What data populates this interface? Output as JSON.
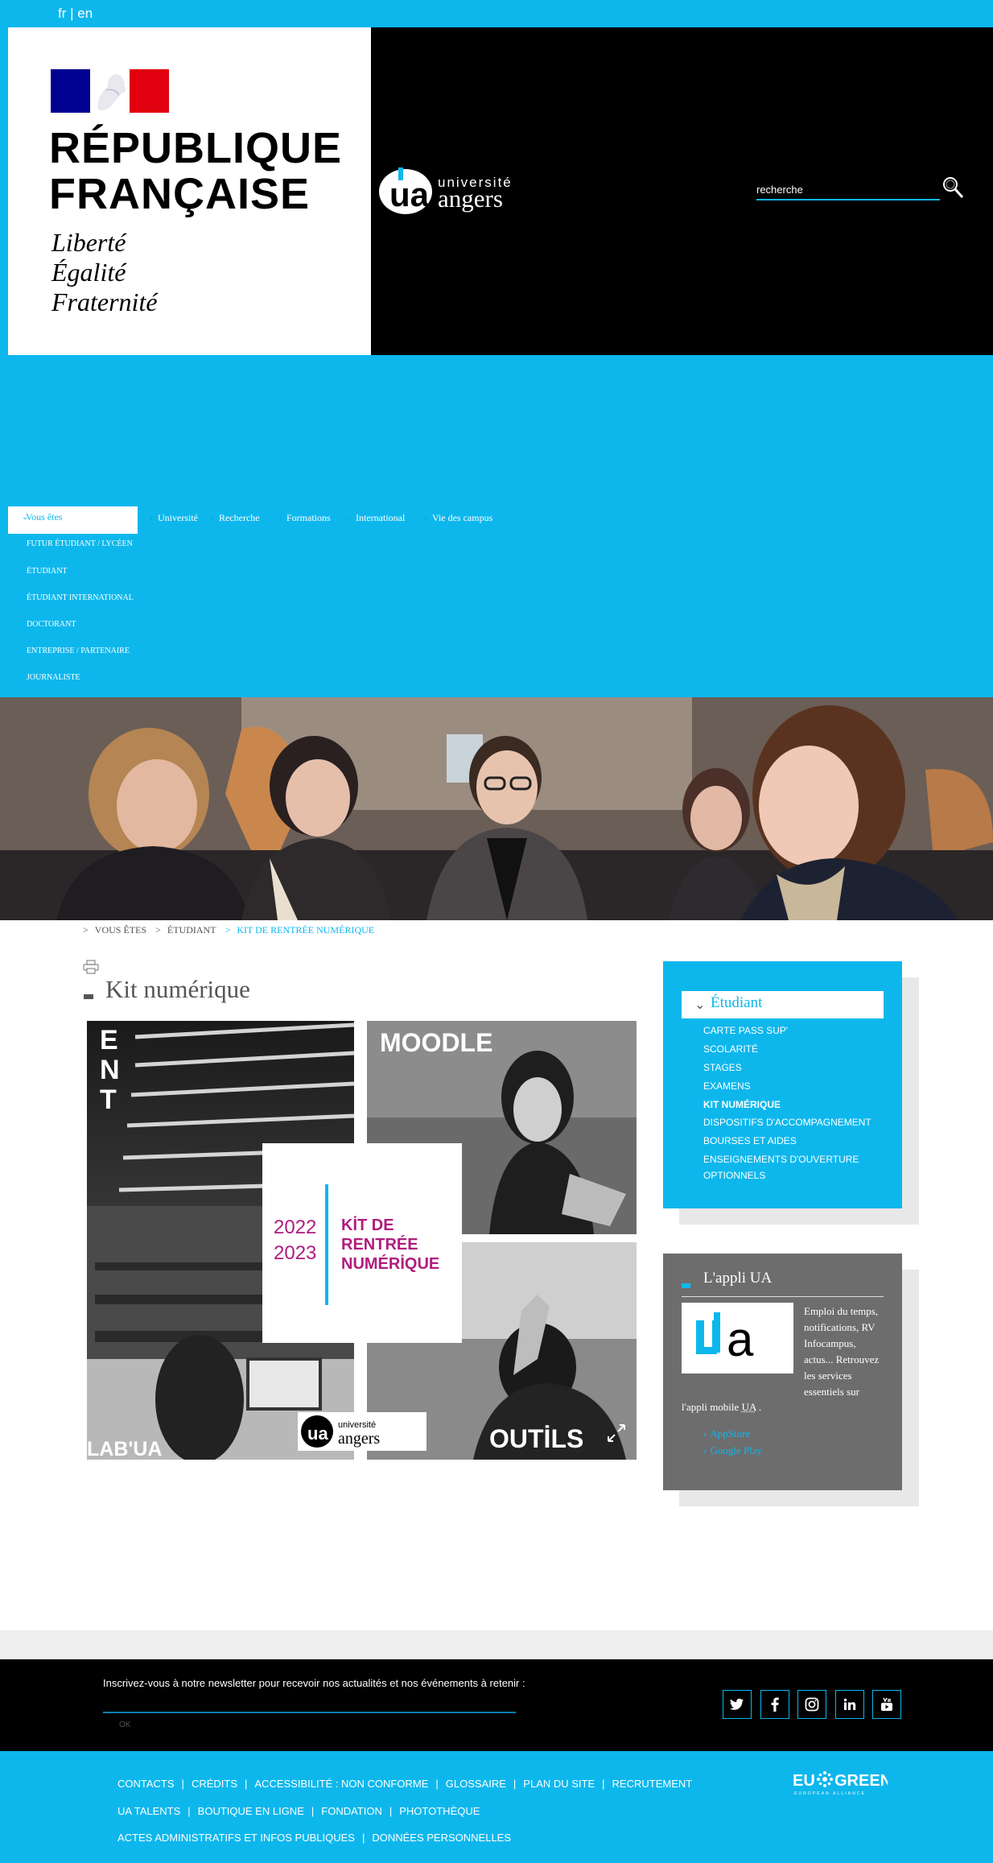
{
  "lang": {
    "fr": "fr",
    "separator": " | ",
    "en": "en"
  },
  "rf": {
    "line1": "RÉPUBLIQUE",
    "line2": "FRANÇAISE",
    "motto1": "Liberté",
    "motto2": "Égalité",
    "motto3": "Fraternité"
  },
  "ua_logo": {
    "top": "université",
    "bottom": "angers"
  },
  "search": {
    "placeholder": "recherche"
  },
  "nav": {
    "vous_etes": "Vous êtes",
    "side_items": [
      "FUTUR ÉTUDIANT / LYCÉEN",
      "ÉTUDIANT",
      "ÉTUDIANT INTERNATIONAL",
      "DOCTORANT",
      "ENTREPRISE / PARTENAIRE",
      "JOURNALISTE"
    ],
    "top_items": [
      "Université",
      "Recherche",
      "Formations",
      "International",
      "Vie des campus"
    ]
  },
  "breadcrumb": {
    "sep": ">",
    "item1": "VOUS ÊTES",
    "item2": "ÉTUDIANT",
    "item3": "KIT DE RENTRÉE NUMÉRIQUE"
  },
  "page": {
    "title": "Kit numérique"
  },
  "kit": {
    "ent_letters": [
      "E",
      "N",
      "T"
    ],
    "moodle": "MOODLE",
    "year1": "2022",
    "year2": "2023",
    "kit_line1": "KİT DE",
    "kit_line2": "RENTRÉE",
    "kit_line3": "NUMÉRİQUE",
    "outils": "OUTİLS",
    "lab": "LAB'UA",
    "logo_top": "université",
    "logo_bottom": "angers"
  },
  "etudiant_card": {
    "title": "Étudiant",
    "items": [
      "CARTE PASS SUP'",
      "SCOLARITÉ",
      "STAGES",
      "EXAMENS",
      "KIT NUMÉRIQUE",
      "DISPOSITIFS D'ACCOMPAGNEMENT",
      "BOURSES ET AIDES",
      "ENSEIGNEMENTS D'OUVERTURE",
      "OPTIONNELS"
    ]
  },
  "app_card": {
    "title": "L'appli UA",
    "text_lines": [
      "Emploi du temps,",
      "notifications, RV",
      "Infocampus,",
      "actus... Retrouvez",
      "les services",
      "essentiels sur"
    ],
    "text_tail": "l'appli mobile ",
    "abbr": "UA",
    "text_end": " .",
    "links": [
      "AppStore",
      "Google Play"
    ]
  },
  "newsletter": {
    "text": "Inscrivez-vous à notre newsletter pour recevoir nos actualités et nos événements à retenir :",
    "ok": "OK"
  },
  "footer": {
    "row1": [
      "CONTACTS",
      "CRÉDITS",
      "ACCESSIBILITÉ : NON CONFORME",
      "GLOSSAIRE",
      "PLAN DU SITE",
      "RECRUTEMENT"
    ],
    "row2": [
      "UA TALENTS",
      "BOUTIQUE EN LIGNE",
      "FONDATION",
      "PHOTOTHÈQUE"
    ],
    "row3": [
      "ACTES ADMINISTRATIFS ET INFOS PUBLIQUES",
      "DONNÉES PERSONNELLES"
    ],
    "separator": "|",
    "eu_green": {
      "left": "EU",
      "right": "GREEN",
      "sub": "EUROPEAN ALLIANCE"
    }
  },
  "colors": {
    "accent": "#0db7ec",
    "black": "#000000",
    "gray_card": "#6d6d6d",
    "kit_magenta": "#b01c7e"
  },
  "icons": [
    "search-icon",
    "print-icon",
    "chevron-down-icon",
    "expand-icon",
    "twitter-icon",
    "facebook-icon",
    "instagram-icon",
    "linkedin-icon",
    "youtube-icon"
  ]
}
